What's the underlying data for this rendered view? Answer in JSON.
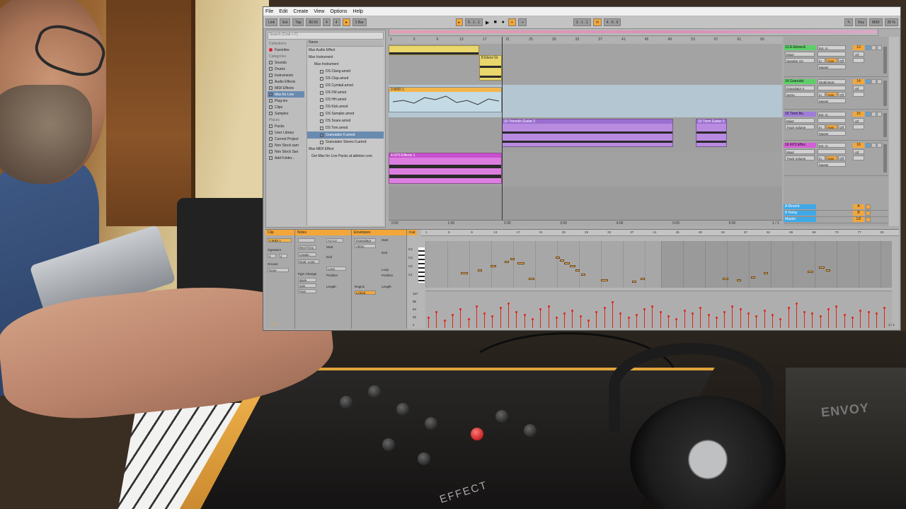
{
  "menu": [
    "File",
    "Edit",
    "Create",
    "View",
    "Options",
    "Help"
  ],
  "transport": {
    "link": "Link",
    "ext": "Ext",
    "tap": "Tap",
    "tempo": "80.00",
    "signature_num": "4",
    "signature_den": "4",
    "quantize": "1 Bar",
    "position": "5 . 1 . 1",
    "loop_start": "3 . 1 . 1",
    "loop_length": "4 . 0 . 0",
    "key": "Key",
    "midi": "MIDI",
    "cpu": "20 %"
  },
  "browser": {
    "search_placeholder": "Search (Cmd + F)",
    "collections_header": "Collections",
    "favorites": "Favorites",
    "categories_header": "Categories",
    "categories": [
      "Sounds",
      "Drums",
      "Instruments",
      "Audio Effects",
      "MIDI Effects",
      "Max for Live",
      "Plug-ins",
      "Clips",
      "Samples"
    ],
    "selected_category": "Max for Live",
    "places_header": "Places",
    "places": [
      "Packs",
      "User Library",
      "Current Project",
      "Non Stock sam",
      "Non Stock San",
      "Add Folder..."
    ],
    "name_header": "Name",
    "files": [
      "Max Audio Effect",
      "Max Instrument",
      "Max Instrument",
      "DS Clang.amxd",
      "DS Clap.amxd",
      "DS Cymbal.amxd",
      "DS FM.amxd",
      "DS HH.amxd",
      "DS Kick.amxd",
      "DS Sampler.amxd",
      "DS Snare.amxd",
      "DS Tom.amxd",
      "Granulator II.amxd",
      "Granulator Stereo II.amxd",
      "Max MIDI Effect",
      "Get Max for Live Packs at ableton.com"
    ],
    "selected_file": "Granulator II.amxd"
  },
  "arrangement": {
    "ruler": [
      "1",
      "5",
      "9",
      "13",
      "17",
      "21",
      "25",
      "29",
      "33",
      "37",
      "41",
      "45",
      "49",
      "53",
      "57",
      "61",
      "65"
    ],
    "time_labels": [
      "0:00",
      "1:00",
      "2:00",
      "3:00",
      "4:00",
      "5:00",
      "6:00"
    ],
    "tracks": [
      {
        "clip_name": "",
        "clip2_name": "8 Ebow Gt",
        "color": "#e9d66c"
      },
      {
        "clip_name": "3 MIDI 1",
        "color": "#f3b44a"
      },
      {
        "clip_name": "10 Tremolo Guitar 2",
        "clip2_name": "10 Trem Guitar 3",
        "color": "#b37cd8"
      },
      {
        "clip_name": "4 KP3 Effects 1",
        "color": "#d45fd6"
      }
    ],
    "page_counter": "1 / 1"
  },
  "mixer": {
    "rows": [
      {
        "name": "13 E-Ebow-E",
        "inp": "Ext. In",
        "sub": "Mixer",
        "mon": "Speaker On",
        "out": "Master",
        "num": "13",
        "color": "#5fce6a"
      },
      {
        "name": "14 Granulat",
        "inp": "Studiologic",
        "sub": "Granulator II",
        "mon": "Spray",
        "out": "Master",
        "num": "14",
        "color": "#5fce6a"
      },
      {
        "name": "15 Trem Bu",
        "inp": "Ext. In",
        "sub": "Mixer",
        "mon": "Track Volume",
        "out": "Master",
        "num": "15",
        "color": "#9f7cd8"
      },
      {
        "name": "16 KP3 Effec",
        "inp": "Ext. In",
        "sub": "Mixer",
        "mon": "Track Volume",
        "out": "Master",
        "num": "16",
        "color": "#d45fd6"
      }
    ],
    "returns": [
      {
        "name": "A Reverb",
        "num": "A"
      },
      {
        "name": "B Delay",
        "num": "B"
      },
      {
        "name": "Master",
        "num": "1/2"
      }
    ],
    "in_label": "In",
    "auto_label": "Auto",
    "off_label": "Off",
    "inf": "-inf"
  },
  "detail": {
    "clip_tab": "Clip",
    "notes_tab": "Notes",
    "envelopes_tab": "Envelopes",
    "clip_name": "3 MIDI 1",
    "signature_label": "Signature",
    "sig_num": "4",
    "sig_den": "4",
    "groove_label": "Groove",
    "groove_value": "None",
    "range": "A1-C4",
    "rev": "Rev",
    "inv": "Inv",
    "legato": "Legato",
    "dupl": "Dupl. Loop",
    "pgm_change": "Pgm Change",
    "bank": "Bank",
    "sub": "Sub",
    "pgm": "Pgm",
    "start_label": "Start",
    "end_label": "End",
    "loop_label": "Loop",
    "position_label": "Position",
    "length_label": "Length",
    "env_device": "Granulator",
    "env_param": "Attrac",
    "region_label": "Region",
    "linked": "Linked",
    "fold": "Fold",
    "note_ruler": [
      "1",
      "5",
      "9",
      "13",
      "17",
      "21",
      "25",
      "29",
      "33",
      "37",
      "41",
      "45",
      "49",
      "53",
      "57",
      "61",
      "65",
      "69",
      "73",
      "77",
      "81"
    ],
    "velocity_scale": [
      "127",
      "96",
      "64",
      "32",
      "1"
    ],
    "piano_labels": [
      "C4",
      "C3",
      "C2",
      "C1"
    ],
    "page_counter": "1 / 1"
  },
  "overlay_text": {
    "effect": "EFFECT",
    "box": "ENVOY"
  }
}
